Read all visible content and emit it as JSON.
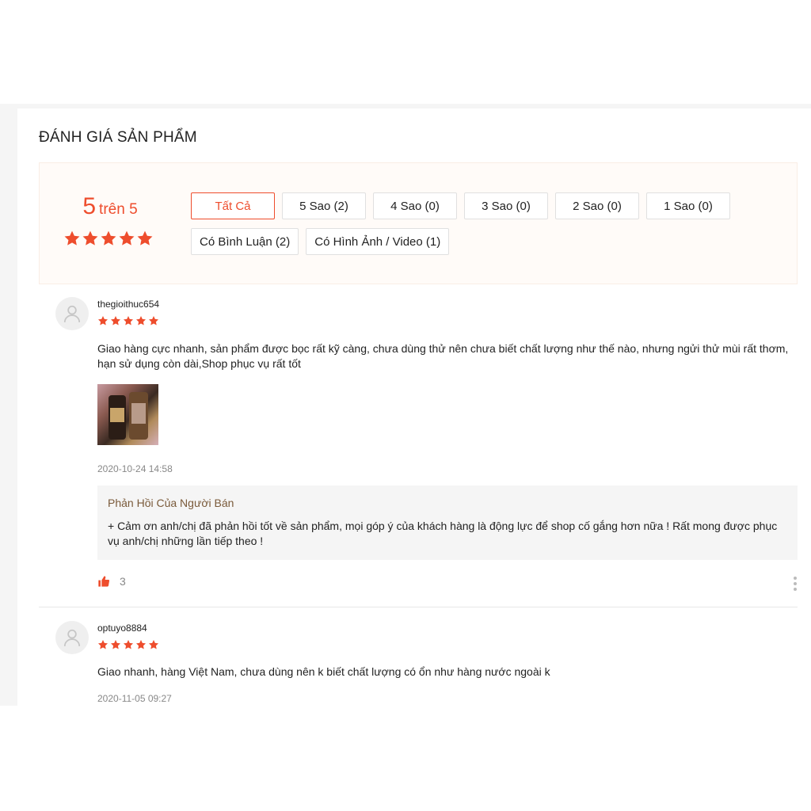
{
  "section_title": "ĐÁNH GIÁ SẢN PHẨM",
  "overview": {
    "score": "5",
    "score_suffix": "trên 5",
    "rating_value": 5,
    "rating_max": 5
  },
  "filters": {
    "row1": [
      {
        "label": "Tất Cả",
        "active": true
      },
      {
        "label": "5 Sao (2)",
        "active": false
      },
      {
        "label": "4 Sao (0)",
        "active": false
      },
      {
        "label": "3 Sao (0)",
        "active": false
      },
      {
        "label": "2 Sao (0)",
        "active": false
      },
      {
        "label": "1 Sao (0)",
        "active": false
      }
    ],
    "row2": [
      {
        "label": "Có Bình Luận (2)",
        "active": false
      },
      {
        "label": "Có Hình Ảnh / Video (1)",
        "active": false
      }
    ]
  },
  "reviews": [
    {
      "username": "thegioithuc654",
      "rating": 5,
      "comment": "Giao hàng cực nhanh, sản phẩm được bọc rất kỹ càng, chưa dùng thử nên chưa biết chất lượng như thế nào, nhưng ngửi thử mùi rất thơm, hạn sử dụng còn dài,Shop phục vụ rất tốt",
      "timestamp": "2020-10-24 14:58",
      "seller_reply_title": "Phản Hồi Của Người Bán",
      "seller_reply": "+ Cảm ơn anh/chị đã phản hồi tốt về sản phẩm, mọi góp ý của khách hàng là động lực để shop cố gắng hơn nữa ! Rất mong được phục vụ anh/chị những lần tiếp theo !",
      "likes": "3"
    },
    {
      "username": "optuyo8884",
      "rating": 5,
      "comment": "Giao nhanh, hàng Việt Nam, chưa dùng nên k biết chất lượng có ổn như hàng nước ngoài k",
      "timestamp": "2020-11-05 09:27"
    }
  ],
  "colors": {
    "accent": "#ee4d2d",
    "seller_title": "#7a5a3a",
    "muted": "#888888"
  },
  "icons": {
    "star": "star-icon",
    "avatar": "user-icon",
    "like": "thumbs-up-icon",
    "more": "more-vertical-icon"
  }
}
